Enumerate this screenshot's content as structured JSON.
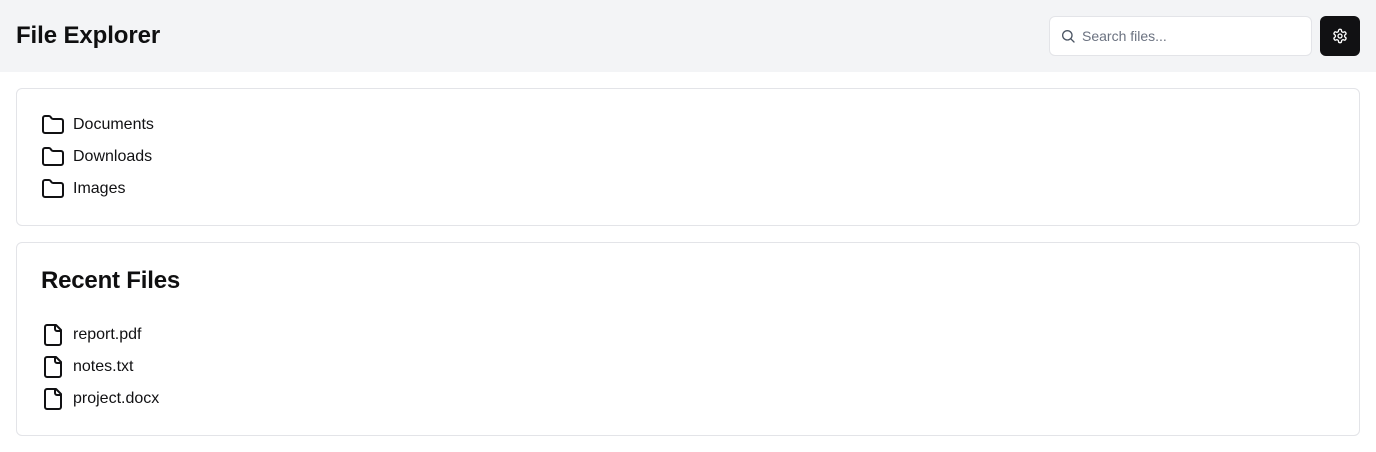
{
  "header": {
    "title": "File Explorer",
    "search": {
      "placeholder": "Search files...",
      "value": "",
      "icon": "search-icon"
    },
    "settings": {
      "icon": "gear-icon",
      "background": "#111113"
    }
  },
  "folders": [
    {
      "label": "Documents",
      "icon": "folder-icon"
    },
    {
      "label": "Downloads",
      "icon": "folder-icon"
    },
    {
      "label": "Images",
      "icon": "folder-icon"
    }
  ],
  "recent": {
    "title": "Recent Files",
    "files": [
      {
        "label": "report.pdf",
        "icon": "file-icon"
      },
      {
        "label": "notes.txt",
        "icon": "file-icon"
      },
      {
        "label": "project.docx",
        "icon": "file-icon"
      }
    ]
  },
  "colors": {
    "header_bg": "#f3f4f6",
    "card_border": "#e3e4e8",
    "text": "#111113"
  }
}
